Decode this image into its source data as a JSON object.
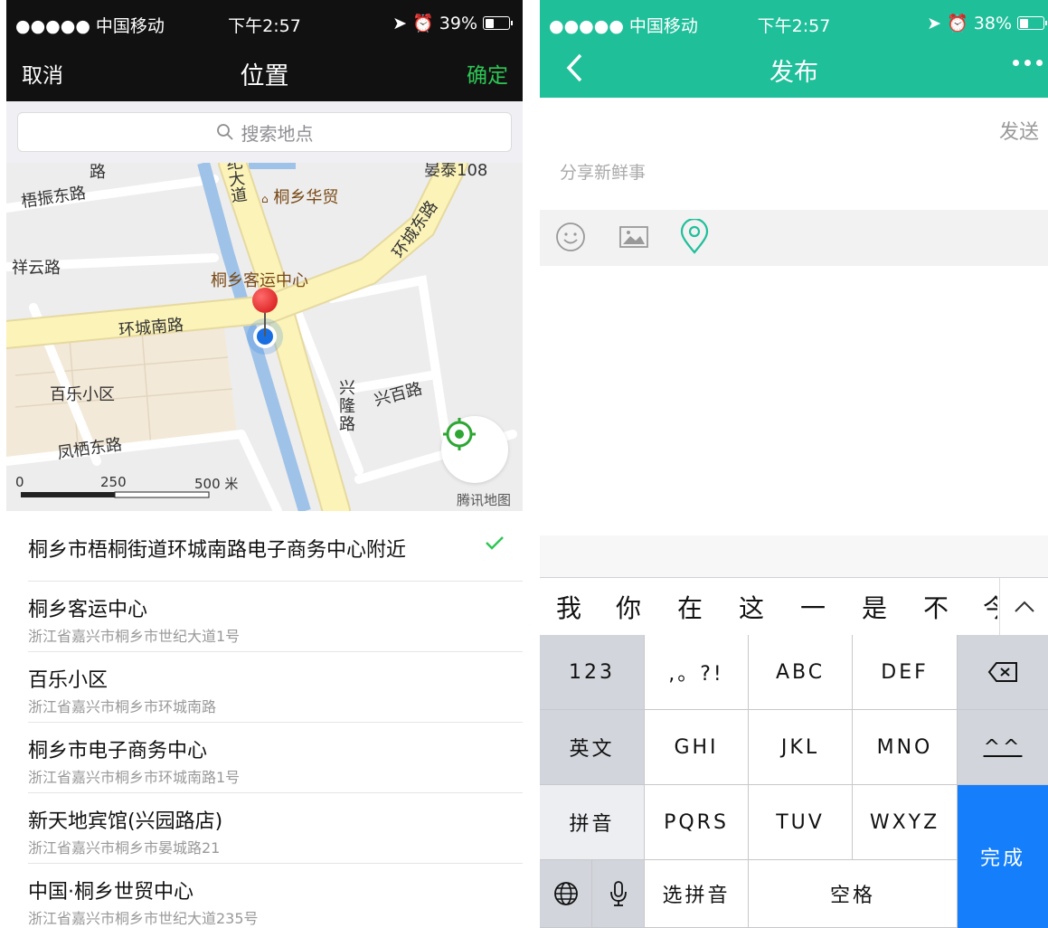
{
  "left": {
    "status": {
      "carrier": "●●●●● 中国移动",
      "time": "下午2:57",
      "battery": "39%",
      "battery_level": 0.39
    },
    "nav": {
      "cancel": "取消",
      "title": "位置",
      "confirm": "确定"
    },
    "search_placeholder": "搜索地点",
    "map": {
      "labels": [
        "梧振东路",
        "祥云路",
        "桐乡华贸",
        "桐乡客运中心",
        "环城南路",
        "百乐小区",
        "凤栖东路",
        "兴隆路",
        "兴百路",
        "环城东路",
        "纪大道",
        "路",
        "晏泰108"
      ],
      "scale": [
        "0",
        "250",
        "500 米"
      ],
      "brand": "腾讯地图"
    },
    "current_location": "桐乡市梧桐街道环城南路电子商务中心附近",
    "places": [
      {
        "name": "桐乡客运中心",
        "address": "浙江省嘉兴市桐乡市世纪大道1号"
      },
      {
        "name": "百乐小区",
        "address": "浙江省嘉兴市桐乡市环城南路"
      },
      {
        "name": "桐乡市电子商务中心",
        "address": "浙江省嘉兴市桐乡市环城南路1号"
      },
      {
        "name": "新天地宾馆(兴园路店)",
        "address": "浙江省嘉兴市桐乡市晏城路21"
      },
      {
        "name": "中国·桐乡世贸中心",
        "address": "浙江省嘉兴市桐乡市世纪大道235号"
      }
    ]
  },
  "right": {
    "status": {
      "carrier": "●●●●● 中国移动",
      "time": "下午2:57",
      "battery": "38%",
      "battery_level": 0.38
    },
    "nav": {
      "title": "发布"
    },
    "send": "发送",
    "compose_placeholder": "分享新鲜事",
    "candidates": [
      "我",
      "你",
      "在",
      "这",
      "一",
      "是",
      "不",
      "今"
    ],
    "keys": {
      "num": "123",
      "punct": ",。?!",
      "abc": "ABC",
      "def": "DEF",
      "english": "英文",
      "ghi": "GHI",
      "jkl": "JKL",
      "mno": "MNO",
      "emoticon": "^^",
      "pinyin": "拼音",
      "pqrs": "PQRS",
      "tuv": "TUV",
      "wxyz": "WXYZ",
      "done": "完成",
      "select_pinyin": "选拼音",
      "space": "空格"
    }
  },
  "colors": {
    "accent_green": "#2ec655",
    "teal": "#1fbf9a",
    "keyboard_blue": "#147efb"
  }
}
